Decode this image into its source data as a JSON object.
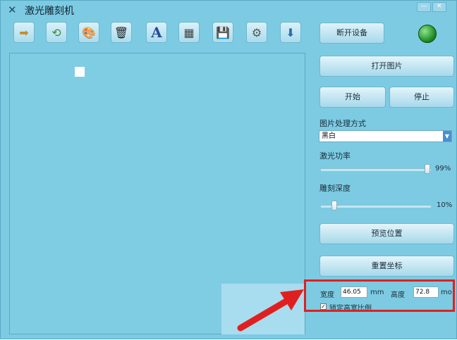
{
  "window": {
    "title": "激光雕刻机",
    "title_icon": "✕",
    "controls": [
      "—",
      "✕"
    ]
  },
  "toolbar": {
    "icons": [
      {
        "name": "forward-arrow-icon",
        "glyph": "➡"
      },
      {
        "name": "refresh-icon",
        "glyph": "⟲"
      },
      {
        "name": "palette-icon",
        "glyph": "🎨"
      },
      {
        "name": "trash-icon",
        "glyph": "🗑"
      },
      {
        "name": "text-icon",
        "glyph": "A"
      },
      {
        "name": "qr-code-icon",
        "glyph": "▦"
      },
      {
        "name": "save-icon",
        "glyph": "💾"
      },
      {
        "name": "gear-icon",
        "glyph": "⚙"
      },
      {
        "name": "download-icon",
        "glyph": "⬇"
      }
    ],
    "connect_label": "断开设备"
  },
  "panel": {
    "open_image_label": "打开图片",
    "start_label": "开始",
    "stop_label": "停止",
    "mode_label": "图片处理方式",
    "mode_value": "黑白",
    "power_label": "激光功率",
    "power_value": "99%",
    "depth_label": "雕刻深度",
    "depth_value": "10%",
    "preview_label": "预览位置",
    "reset_label": "重置坐标",
    "width_label": "宽度",
    "width_value": "46.05",
    "width_unit": "mm",
    "height_label": "高度",
    "height_value": "72.8",
    "height_unit": "mo",
    "lock_label": "锁定高宽比例",
    "lock_checked": "✓"
  },
  "levels": {
    "power": 0.99,
    "depth": 0.1
  },
  "colors": {
    "window_bg": "#7ccbe2",
    "highlight": "#e02020",
    "status_led": "#1e8a22"
  }
}
